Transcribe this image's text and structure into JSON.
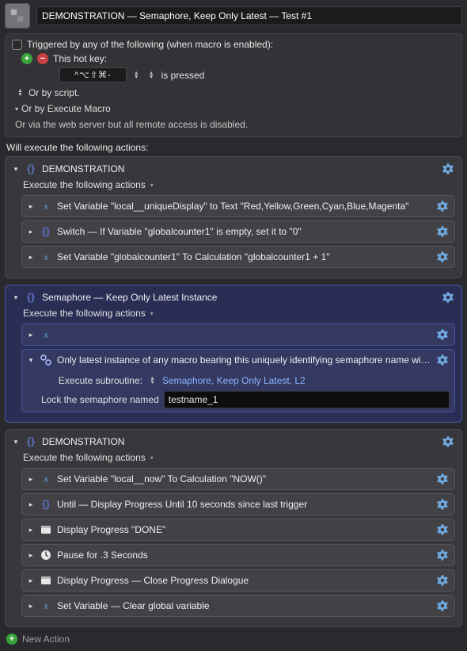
{
  "title": "DEMONSTRATION — Semaphore, Keep Only Latest — Test #1",
  "trigger": {
    "header": "Triggered by any of the following (when macro is enabled):",
    "hotkey_label": "This hot key:",
    "hotkey_value": "^⌥⇧⌘-",
    "hotkey_state": "is pressed",
    "or_script": "Or by script.",
    "or_execute": "Or by Execute Macro",
    "web_disabled": "Or via the web server but all remote access is disabled."
  },
  "exec_label": "Will execute the following actions:",
  "groups": [
    {
      "title": "DEMONSTRATION",
      "subhead": "Execute the following actions",
      "actions": [
        {
          "icon": "var",
          "text": "Set Variable \"local__uniqueDisplay\" to Text \"Red,Yellow,Green,Cyan,Blue,Magenta\""
        },
        {
          "icon": "curly",
          "text": "Switch — If Variable \"globalcounter1\" is empty, set it to \"0\""
        },
        {
          "icon": "var",
          "text": "Set Variable \"globalcounter1\" To Calculation \"globalcounter1 + 1\""
        }
      ]
    },
    {
      "title": "Semaphore — Keep Only Latest Instance",
      "subhead": "Execute the following actions",
      "selected": true,
      "actions": [
        {
          "icon": "var",
          "text": ""
        },
        {
          "icon": "sema",
          "text": "Only latest instance of any macro bearing this uniquely identifying semaphore name will be kept running",
          "expanded": true,
          "sub_label": "Execute subroutine:",
          "sub_select": "Semaphore, Keep Only Latest, L2",
          "lock_label": "Lock the semaphore named",
          "lock_value": "testname_1"
        }
      ]
    },
    {
      "title": "DEMONSTRATION",
      "subhead": "Execute the following actions",
      "actions": [
        {
          "icon": "var",
          "text": "Set Variable \"local__now\" To Calculation \"NOW()\""
        },
        {
          "icon": "curly",
          "text": "Until — Display Progress Until 10 seconds since last trigger"
        },
        {
          "icon": "win",
          "text": "Display Progress \"DONE\""
        },
        {
          "icon": "clock",
          "text": "Pause for .3 Seconds"
        },
        {
          "icon": "win",
          "text": "Display Progress — Close Progress Dialogue"
        },
        {
          "icon": "var",
          "text": "Set Variable — Clear global variable"
        }
      ]
    }
  ],
  "new_action": "New Action"
}
